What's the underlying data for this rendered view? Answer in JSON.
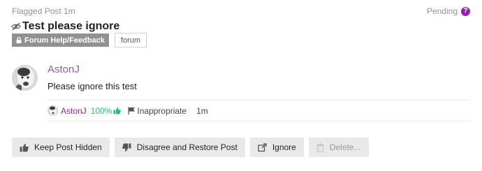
{
  "header": {
    "type_label": "Flagged Post",
    "age": "1m",
    "status": "Pending",
    "help_glyph": "?"
  },
  "post": {
    "title": "Test please ignore",
    "category": "Forum Help/Feedback",
    "tag": "forum",
    "author": "AstonJ",
    "body": "Please ignore this test"
  },
  "flag": {
    "flagger": "AstonJ",
    "score": "100%",
    "reason": "Inappropriate",
    "age": "1m"
  },
  "actions": {
    "keep_hidden": "Keep Post Hidden",
    "disagree_restore": "Disagree and Restore Post",
    "ignore": "Ignore",
    "delete": "Delete..."
  },
  "icons": {
    "help": "help-icon",
    "hidden": "eye-slash-icon",
    "lock": "lock-icon",
    "thumbs_up": "thumbs-up-icon",
    "thumbs_down": "thumbs-down-icon",
    "flag": "flag-icon",
    "ignore": "external-link-icon",
    "delete": "trash-icon"
  },
  "colors": {
    "accent_purple": "#8e24aa",
    "author_purple": "#8c5ea0",
    "score_green": "#2dbb75",
    "badge_gray": "#919191",
    "button_bg": "#e9e9e9"
  }
}
